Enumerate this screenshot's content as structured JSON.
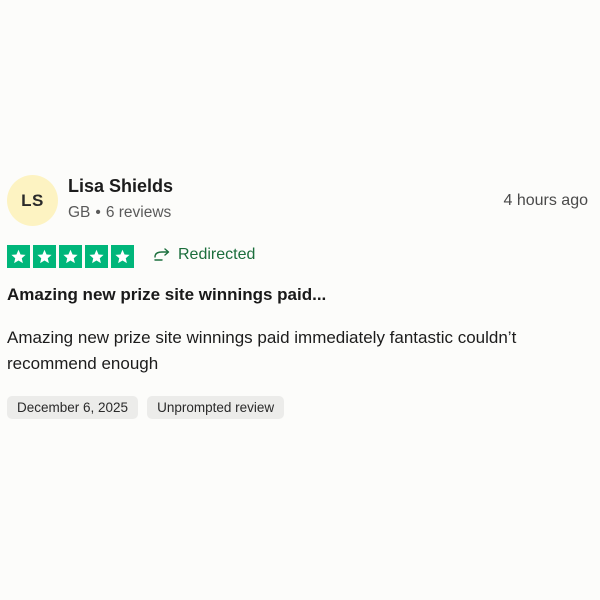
{
  "reviewer": {
    "initials": "LS",
    "name": "Lisa Shields",
    "country": "GB",
    "separator": "•",
    "review_count": "6 reviews",
    "avatar_color": "#fdf3c2"
  },
  "timestamp": "4 hours ago",
  "rating": {
    "stars": 5,
    "max": 5,
    "star_color": "#00b67a",
    "icon": "star-icon"
  },
  "status": {
    "label": "Redirected",
    "icon": "redirect-arrow-icon",
    "color": "#1b6e3c"
  },
  "review": {
    "title": "Amazing new prize site winnings paid...",
    "body": "Amazing new prize site winnings paid immediately fantastic couldn’t recommend enough"
  },
  "tags": {
    "date": "December 6, 2025",
    "type": "Unprompted review"
  }
}
